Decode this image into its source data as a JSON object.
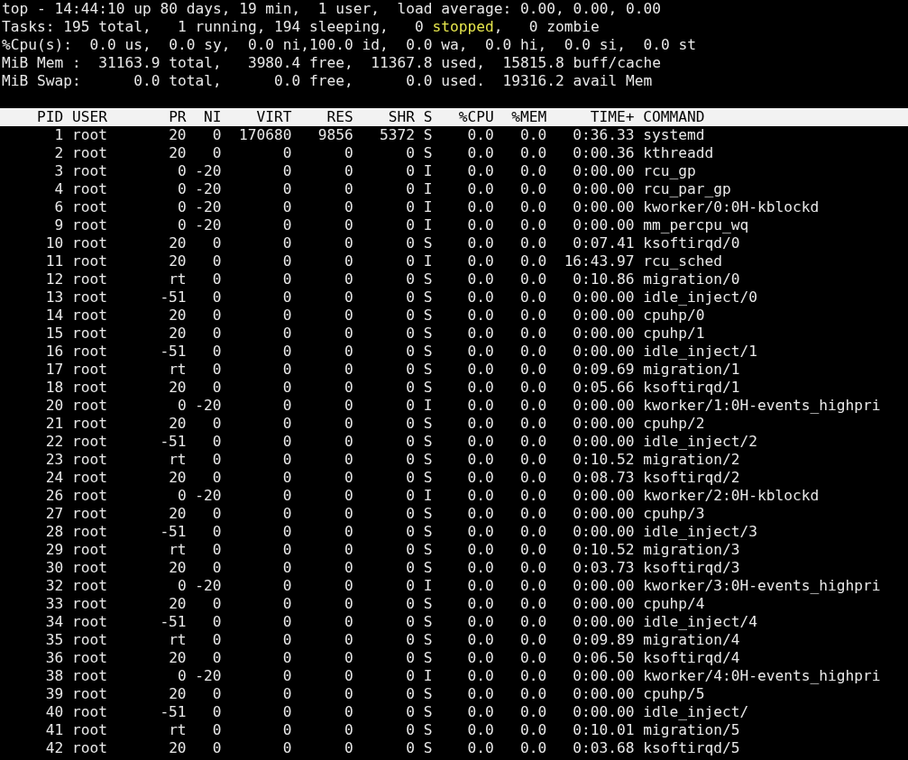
{
  "summary_lines": [
    [
      {
        "text": "top - 14:44:10 up 80 days, 19 min,  1 user,  load average: 0.00, 0.00, 0.00",
        "highlighted": false
      }
    ],
    [
      {
        "text": "Tasks: 195 total,   1 running, 194 sleeping,   0 ",
        "highlighted": false
      },
      {
        "text": "stopped",
        "highlighted": true
      },
      {
        "text": ",   0 zombie",
        "highlighted": false
      }
    ],
    [
      {
        "text": "%Cpu(s):  0.0 us,  0.0 sy,  0.0 ni,100.0 id,  0.0 wa,  0.0 hi,  0.0 si,  0.0 st",
        "highlighted": false
      }
    ],
    [
      {
        "text": "MiB Mem :  31163.9 total,   3980.4 free,  11367.8 used,  15815.8 buff/cache",
        "highlighted": false
      }
    ],
    [
      {
        "text": "MiB Swap:      0.0 total,      0.0 free,      0.0 used.  19316.2 avail Mem",
        "highlighted": false
      }
    ]
  ],
  "table": {
    "columns": [
      "PID",
      "USER",
      "PR",
      "NI",
      "VIRT",
      "RES",
      "SHR",
      "S",
      "%CPU",
      "%MEM",
      "TIME+",
      "COMMAND"
    ],
    "rows": [
      [
        "1",
        "root",
        "20",
        "0",
        "170680",
        "9856",
        "5372",
        "S",
        "0.0",
        "0.0",
        "0:36.33",
        "systemd"
      ],
      [
        "2",
        "root",
        "20",
        "0",
        "0",
        "0",
        "0",
        "S",
        "0.0",
        "0.0",
        "0:00.36",
        "kthreadd"
      ],
      [
        "3",
        "root",
        "0",
        "-20",
        "0",
        "0",
        "0",
        "I",
        "0.0",
        "0.0",
        "0:00.00",
        "rcu_gp"
      ],
      [
        "4",
        "root",
        "0",
        "-20",
        "0",
        "0",
        "0",
        "I",
        "0.0",
        "0.0",
        "0:00.00",
        "rcu_par_gp"
      ],
      [
        "6",
        "root",
        "0",
        "-20",
        "0",
        "0",
        "0",
        "I",
        "0.0",
        "0.0",
        "0:00.00",
        "kworker/0:0H-kblockd"
      ],
      [
        "9",
        "root",
        "0",
        "-20",
        "0",
        "0",
        "0",
        "I",
        "0.0",
        "0.0",
        "0:00.00",
        "mm_percpu_wq"
      ],
      [
        "10",
        "root",
        "20",
        "0",
        "0",
        "0",
        "0",
        "S",
        "0.0",
        "0.0",
        "0:07.41",
        "ksoftirqd/0"
      ],
      [
        "11",
        "root",
        "20",
        "0",
        "0",
        "0",
        "0",
        "I",
        "0.0",
        "0.0",
        "16:43.97",
        "rcu_sched"
      ],
      [
        "12",
        "root",
        "rt",
        "0",
        "0",
        "0",
        "0",
        "S",
        "0.0",
        "0.0",
        "0:10.86",
        "migration/0"
      ],
      [
        "13",
        "root",
        "-51",
        "0",
        "0",
        "0",
        "0",
        "S",
        "0.0",
        "0.0",
        "0:00.00",
        "idle_inject/0"
      ],
      [
        "14",
        "root",
        "20",
        "0",
        "0",
        "0",
        "0",
        "S",
        "0.0",
        "0.0",
        "0:00.00",
        "cpuhp/0"
      ],
      [
        "15",
        "root",
        "20",
        "0",
        "0",
        "0",
        "0",
        "S",
        "0.0",
        "0.0",
        "0:00.00",
        "cpuhp/1"
      ],
      [
        "16",
        "root",
        "-51",
        "0",
        "0",
        "0",
        "0",
        "S",
        "0.0",
        "0.0",
        "0:00.00",
        "idle_inject/1"
      ],
      [
        "17",
        "root",
        "rt",
        "0",
        "0",
        "0",
        "0",
        "S",
        "0.0",
        "0.0",
        "0:09.69",
        "migration/1"
      ],
      [
        "18",
        "root",
        "20",
        "0",
        "0",
        "0",
        "0",
        "S",
        "0.0",
        "0.0",
        "0:05.66",
        "ksoftirqd/1"
      ],
      [
        "20",
        "root",
        "0",
        "-20",
        "0",
        "0",
        "0",
        "I",
        "0.0",
        "0.0",
        "0:00.00",
        "kworker/1:0H-events_highpri"
      ],
      [
        "21",
        "root",
        "20",
        "0",
        "0",
        "0",
        "0",
        "S",
        "0.0",
        "0.0",
        "0:00.00",
        "cpuhp/2"
      ],
      [
        "22",
        "root",
        "-51",
        "0",
        "0",
        "0",
        "0",
        "S",
        "0.0",
        "0.0",
        "0:00.00",
        "idle_inject/2"
      ],
      [
        "23",
        "root",
        "rt",
        "0",
        "0",
        "0",
        "0",
        "S",
        "0.0",
        "0.0",
        "0:10.52",
        "migration/2"
      ],
      [
        "24",
        "root",
        "20",
        "0",
        "0",
        "0",
        "0",
        "S",
        "0.0",
        "0.0",
        "0:08.73",
        "ksoftirqd/2"
      ],
      [
        "26",
        "root",
        "0",
        "-20",
        "0",
        "0",
        "0",
        "I",
        "0.0",
        "0.0",
        "0:00.00",
        "kworker/2:0H-kblockd"
      ],
      [
        "27",
        "root",
        "20",
        "0",
        "0",
        "0",
        "0",
        "S",
        "0.0",
        "0.0",
        "0:00.00",
        "cpuhp/3"
      ],
      [
        "28",
        "root",
        "-51",
        "0",
        "0",
        "0",
        "0",
        "S",
        "0.0",
        "0.0",
        "0:00.00",
        "idle_inject/3"
      ],
      [
        "29",
        "root",
        "rt",
        "0",
        "0",
        "0",
        "0",
        "S",
        "0.0",
        "0.0",
        "0:10.52",
        "migration/3"
      ],
      [
        "30",
        "root",
        "20",
        "0",
        "0",
        "0",
        "0",
        "S",
        "0.0",
        "0.0",
        "0:03.73",
        "ksoftirqd/3"
      ],
      [
        "32",
        "root",
        "0",
        "-20",
        "0",
        "0",
        "0",
        "I",
        "0.0",
        "0.0",
        "0:00.00",
        "kworker/3:0H-events_highpri"
      ],
      [
        "33",
        "root",
        "20",
        "0",
        "0",
        "0",
        "0",
        "S",
        "0.0",
        "0.0",
        "0:00.00",
        "cpuhp/4"
      ],
      [
        "34",
        "root",
        "-51",
        "0",
        "0",
        "0",
        "0",
        "S",
        "0.0",
        "0.0",
        "0:00.00",
        "idle_inject/4"
      ],
      [
        "35",
        "root",
        "rt",
        "0",
        "0",
        "0",
        "0",
        "S",
        "0.0",
        "0.0",
        "0:09.89",
        "migration/4"
      ],
      [
        "36",
        "root",
        "20",
        "0",
        "0",
        "0",
        "0",
        "S",
        "0.0",
        "0.0",
        "0:06.50",
        "ksoftirqd/4"
      ],
      [
        "38",
        "root",
        "0",
        "-20",
        "0",
        "0",
        "0",
        "I",
        "0.0",
        "0.0",
        "0:00.00",
        "kworker/4:0H-events_highpri"
      ],
      [
        "39",
        "root",
        "20",
        "0",
        "0",
        "0",
        "0",
        "S",
        "0.0",
        "0.0",
        "0:00.00",
        "cpuhp/5"
      ],
      [
        "40",
        "root",
        "-51",
        "0",
        "0",
        "0",
        "0",
        "S",
        "0.0",
        "0.0",
        "0:00.00",
        "idle_inject/"
      ],
      [
        "41",
        "root",
        "rt",
        "0",
        "0",
        "0",
        "0",
        "S",
        "0.0",
        "0.0",
        "0:10.01",
        "migration/5"
      ],
      [
        "42",
        "root",
        "20",
        "0",
        "0",
        "0",
        "0",
        "S",
        "0.0",
        "0.0",
        "0:03.68",
        "ksoftirqd/5"
      ]
    ]
  }
}
